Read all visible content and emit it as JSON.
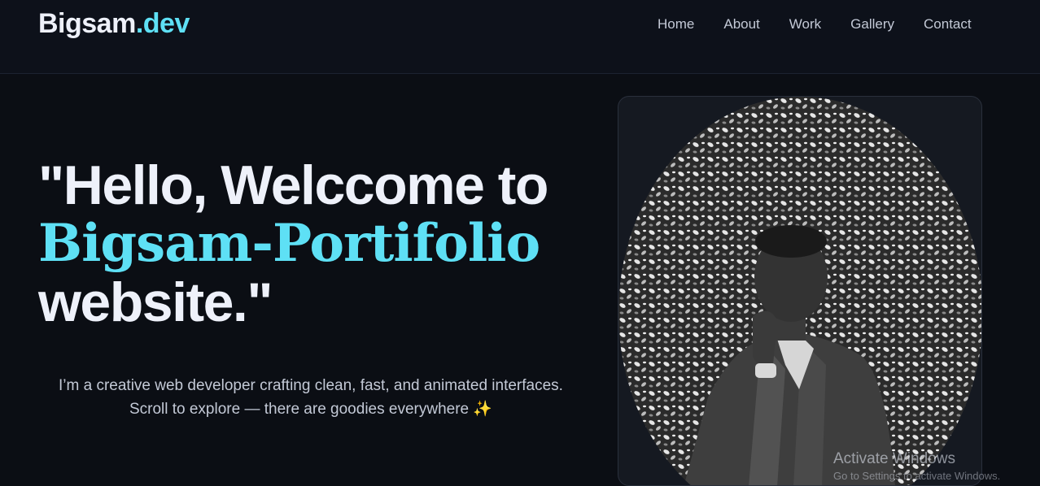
{
  "header": {
    "logo_brand": "Bigsam",
    "logo_tld": ".dev",
    "nav": [
      "Home",
      "About",
      "Work",
      "Gallery",
      "Contact"
    ]
  },
  "hero": {
    "title_line1": "\"Hello, Welccome to",
    "title_accent": "Bigsam-Portifolio",
    "title_line3": "website.\"",
    "subtitle_line1": "I’m a creative web developer crafting clean, fast, and animated interfaces.",
    "subtitle_line2": "Scroll to explore — there are goodies everywhere",
    "sparkle": "✨"
  },
  "portrait": {
    "alt_desc_icon": "portrait-photo"
  },
  "overlay": {
    "activate_title": "Activate Windows",
    "activate_sub": "Go to Settings to activate Windows."
  },
  "colors": {
    "background": "#0b0e14",
    "accent": "#5ee0f5",
    "text": "#eef1fa",
    "muted": "#c3c9d6"
  }
}
